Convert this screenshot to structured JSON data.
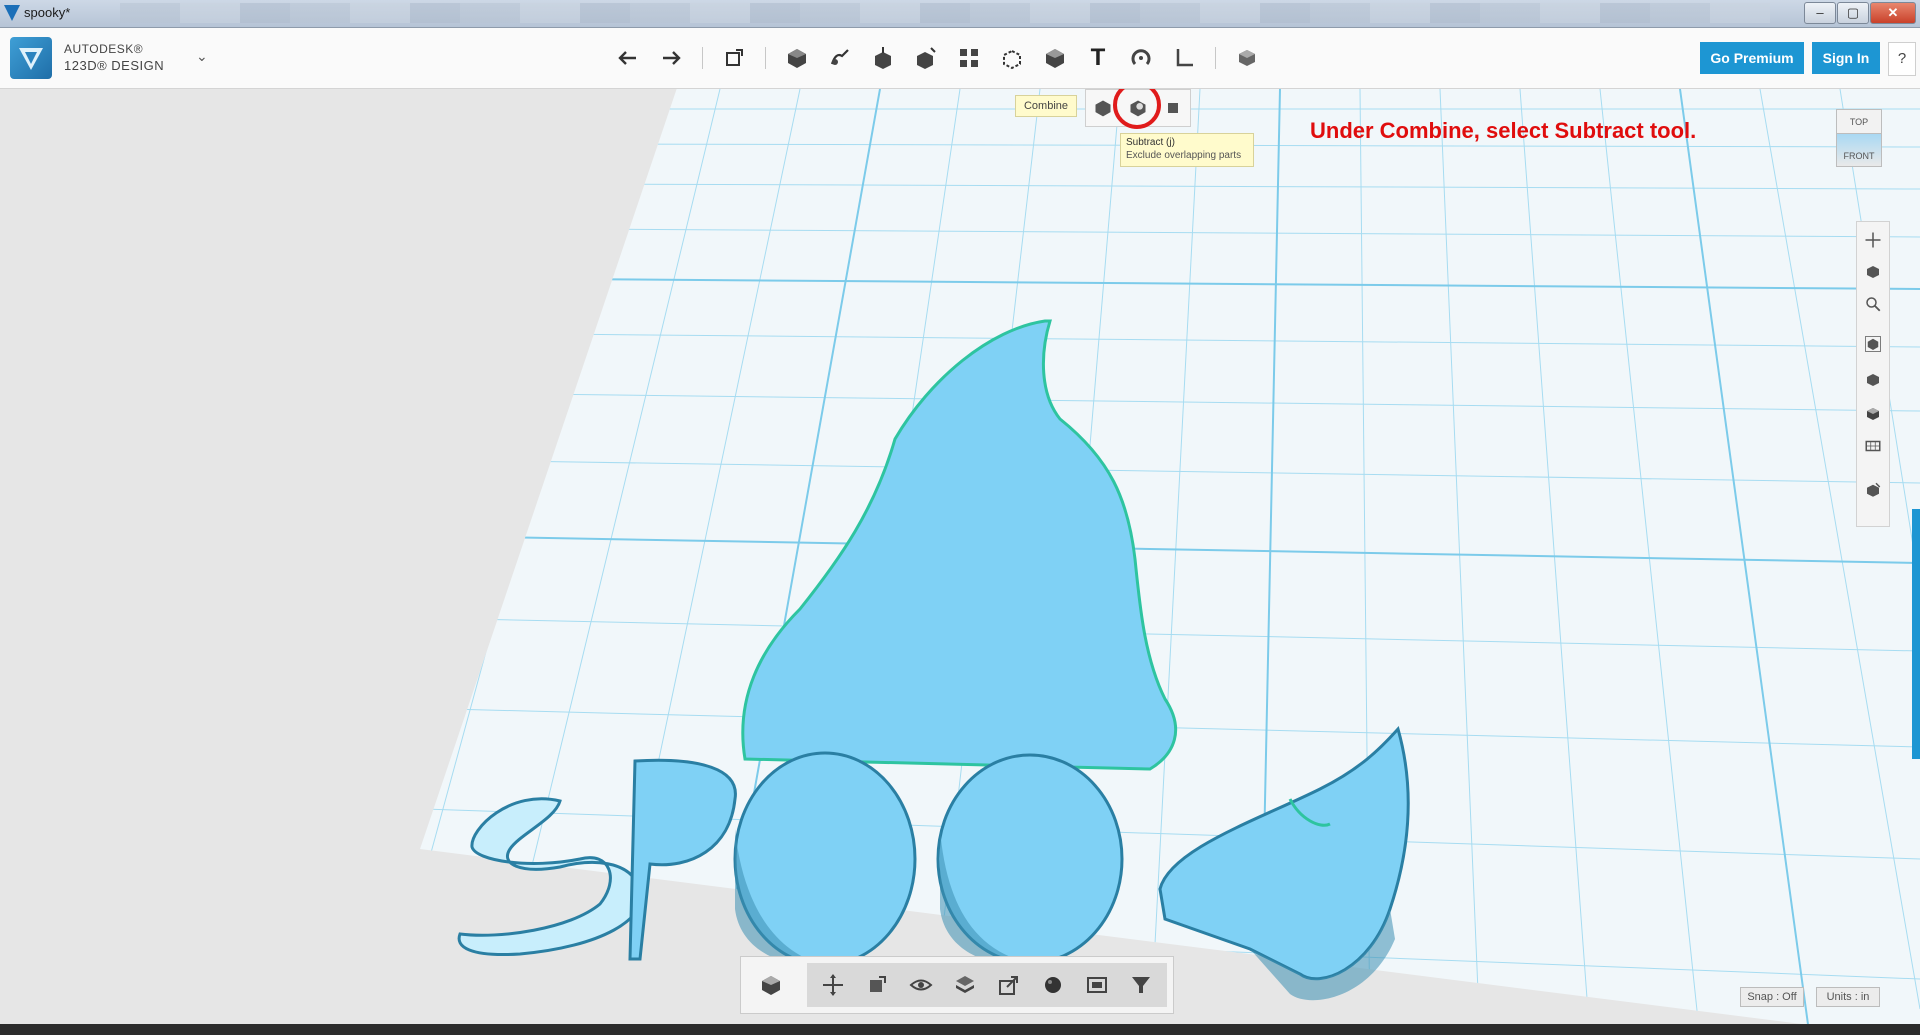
{
  "window": {
    "title": "spooky*",
    "minimize": "–",
    "maximize": "▢",
    "close": "✕"
  },
  "app": {
    "brand_line1": "AUTODESK®",
    "brand_line2": "123D® DESIGN",
    "menu_caret": "⌄"
  },
  "toolbar": {
    "undo_icon": "undo-arrow-icon",
    "redo_icon": "redo-arrow-icon",
    "text_tool_label": "T",
    "go_premium_label": "Go Premium",
    "sign_in_label": "Sign In",
    "help_label": "?"
  },
  "combine": {
    "label": "Combine",
    "tooltip_title": "Subtract (j)",
    "tooltip_desc": "Exclude overlapping parts"
  },
  "annotation": {
    "text": "Under Combine, select Subtract tool."
  },
  "viewcube": {
    "top_label": "TOP",
    "front_label": "FRONT"
  },
  "status": {
    "snap": "Snap : Off",
    "units": "Units : in"
  },
  "colors": {
    "accent": "#1d96d3",
    "model_fill": "#7fd1f5",
    "model_outline": "#2ec4a0",
    "grid": "#8fd3ee",
    "annotation": "#e00d0d"
  }
}
